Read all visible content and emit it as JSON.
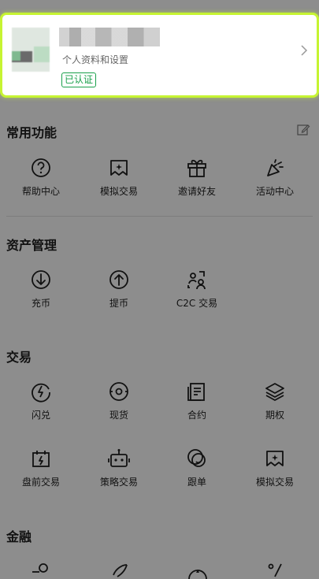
{
  "profile": {
    "subtitle": "个人资料和设置",
    "badge": "已认证"
  },
  "sections": {
    "common": {
      "title": "常用功能",
      "items": [
        "帮助中心",
        "模拟交易",
        "邀请好友",
        "活动中心"
      ]
    },
    "assets": {
      "title": "资产管理",
      "items": [
        "充币",
        "提币",
        "C2C 交易"
      ]
    },
    "trade": {
      "title": "交易",
      "items": [
        "闪兑",
        "现货",
        "合约",
        "期权",
        "盘前交易",
        "策略交易",
        "跟单",
        "模拟交易"
      ]
    },
    "finance": {
      "title": "金融"
    }
  },
  "colors": {
    "overlay": "#8d8d8d",
    "highlight": "#c6f432",
    "verified": "#19a04a"
  }
}
